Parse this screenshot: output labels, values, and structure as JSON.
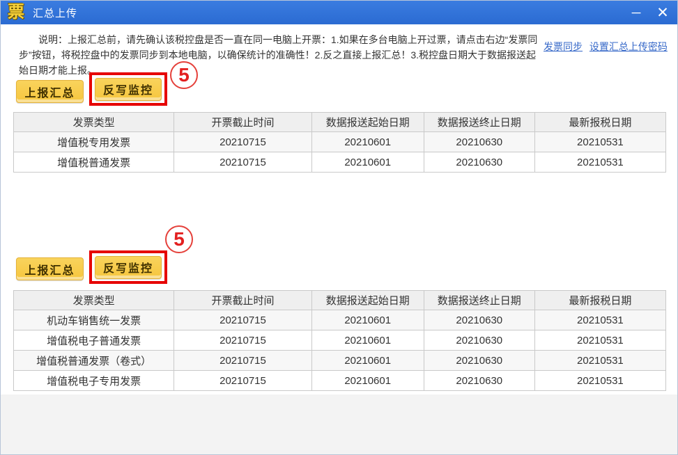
{
  "window": {
    "title": "汇总上传",
    "icon_glyph": "票",
    "controls": {
      "minimize": "─",
      "close": "✕"
    }
  },
  "colors": {
    "titlebar_blue": "#2b6bd2",
    "button_yellow": "#f6c63e",
    "link_blue": "#3668c8",
    "highlight_red": "#e60000"
  },
  "description": "说明：上报汇总前，请先确认该税控盘是否一直在同一电脑上开票：1.如果在多台电脑上开过票，请点击右边“发票同步”按钮，将税控盘中的发票同步到本地电脑，以确保统计的准确性！2.反之直接上报汇总！3.税控盘日期大于数据报送起始日期才能上报。",
  "links": [
    {
      "label": "发票同步"
    },
    {
      "label": "设置汇总上传密码"
    }
  ],
  "sections": [
    {
      "buttons": {
        "report": "上报汇总",
        "writeback": "反写监控"
      },
      "annotation": "5",
      "table": {
        "headers": [
          "发票类型",
          "开票截止时间",
          "数据报送起始日期",
          "数据报送终止日期",
          "最新报税日期"
        ],
        "rows": [
          [
            "增值税专用发票",
            "20210715",
            "20210601",
            "20210630",
            "20210531"
          ],
          [
            "增值税普通发票",
            "20210715",
            "20210601",
            "20210630",
            "20210531"
          ]
        ]
      }
    },
    {
      "buttons": {
        "report": "上报汇总",
        "writeback": "反写监控"
      },
      "annotation": "5",
      "table": {
        "headers": [
          "发票类型",
          "开票截止时间",
          "数据报送起始日期",
          "数据报送终止日期",
          "最新报税日期"
        ],
        "rows": [
          [
            "机动车销售统一发票",
            "20210715",
            "20210601",
            "20210630",
            "20210531"
          ],
          [
            "增值税电子普通发票",
            "20210715",
            "20210601",
            "20210630",
            "20210531"
          ],
          [
            "增值税普通发票（卷式）",
            "20210715",
            "20210601",
            "20210630",
            "20210531"
          ],
          [
            "增值税电子专用发票",
            "20210715",
            "20210601",
            "20210630",
            "20210531"
          ]
        ]
      }
    }
  ]
}
